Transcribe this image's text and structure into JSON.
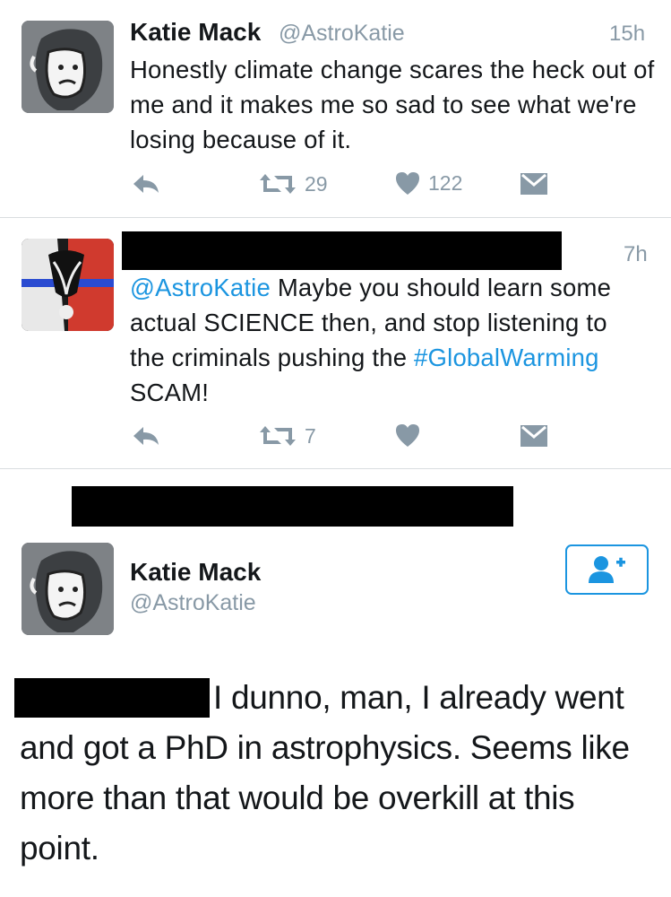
{
  "tweet1": {
    "name": "Katie Mack",
    "handle": "@AstroKatie",
    "time": "15h",
    "text": "Honestly climate change scares the heck out of me and it makes me so sad to see what we're losing because of it.",
    "retweets": "29",
    "likes": "122"
  },
  "tweet2": {
    "time": "7h",
    "mention": "@AstroKatie",
    "text_a": " Maybe you should learn some actual SCIENCE then, and stop listening to the criminals pushing the ",
    "hashtag": "#GlobalWarming",
    "text_b": " SCAM!",
    "retweets": "7"
  },
  "tweet3": {
    "name": "Katie Mack",
    "handle": "@AstroKatie",
    "text": "I dunno, man, I already went and got a PhD in astrophysics. Seems like more than that would be overkill at this point."
  },
  "colors": {
    "link": "#1b95e0",
    "muted": "#8899a6",
    "divider": "#d9dde0"
  }
}
